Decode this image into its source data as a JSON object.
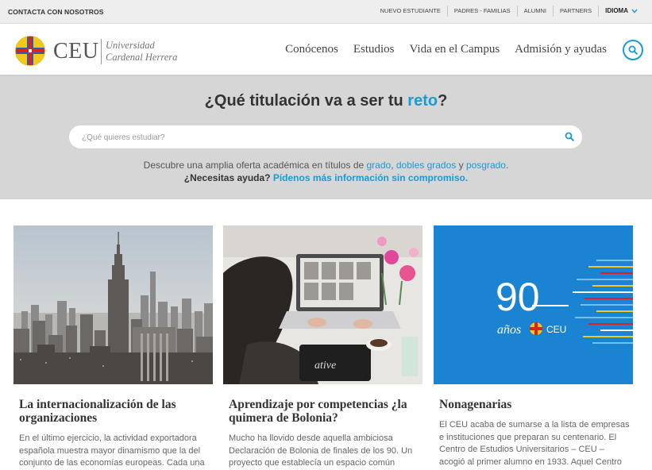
{
  "topbar": {
    "contact": "CONTACTA CON NOSOTROS",
    "links": [
      "NUEVO ESTUDIANTE",
      "PADRES - FAMILIAS",
      "ALUMNI",
      "PARTNERS"
    ],
    "language": "IDIOMA"
  },
  "header": {
    "brand": "CEU",
    "brand_line1": "Universidad",
    "brand_line2": "Cardenal Herrera",
    "nav": [
      "Conócenos",
      "Estudios",
      "Vida en el Campus",
      "Admisión y ayudas"
    ]
  },
  "hero": {
    "title_pre": "¿Qué titulación va a ser tu ",
    "title_accent": "reto",
    "title_post": "?",
    "search_placeholder": "¿Qué quieres estudiar?",
    "desc_pre": "Descubre una amplia oferta académica en títulos de ",
    "link_grado": "grado",
    "sep1": ", ",
    "link_dobles": "dobles grados",
    "sep2": " y ",
    "link_posgrado": "posgrado",
    "desc_end": ".",
    "help_pre": "¿Necesitas ayuda? ",
    "help_link": "Pídenos más información sin compromiso."
  },
  "cards": [
    {
      "title": "La internacionalización de las organizaciones",
      "text": "En el último ejercicio, la actividad exportadora española muestra mayor dinamismo que la del conjunto de las economías europeas. Cada una"
    },
    {
      "title": "Aprendizaje por competencias ¿la quimera de Bolonia?",
      "text": "Mucho ha llovido desde aquella ambiciosa Declaración de Bolonia de finales de los 90. Un proyecto que establecía un espacio común"
    },
    {
      "title": "Nonagenarias",
      "text": "El CEU acaba de sumarse a la lista de empresas e instituciones que preparan su centenario. El Centro de Estudios Universitarios – CEU – acogió al primer alumno en 1933. Aquel Centro",
      "image_number": "90",
      "image_word": "años",
      "image_brand": "CEU"
    }
  ],
  "colors": {
    "accent": "#1a9ad6",
    "hero_bg": "#d6d6d6",
    "card3_bg": "#1a84d2"
  }
}
